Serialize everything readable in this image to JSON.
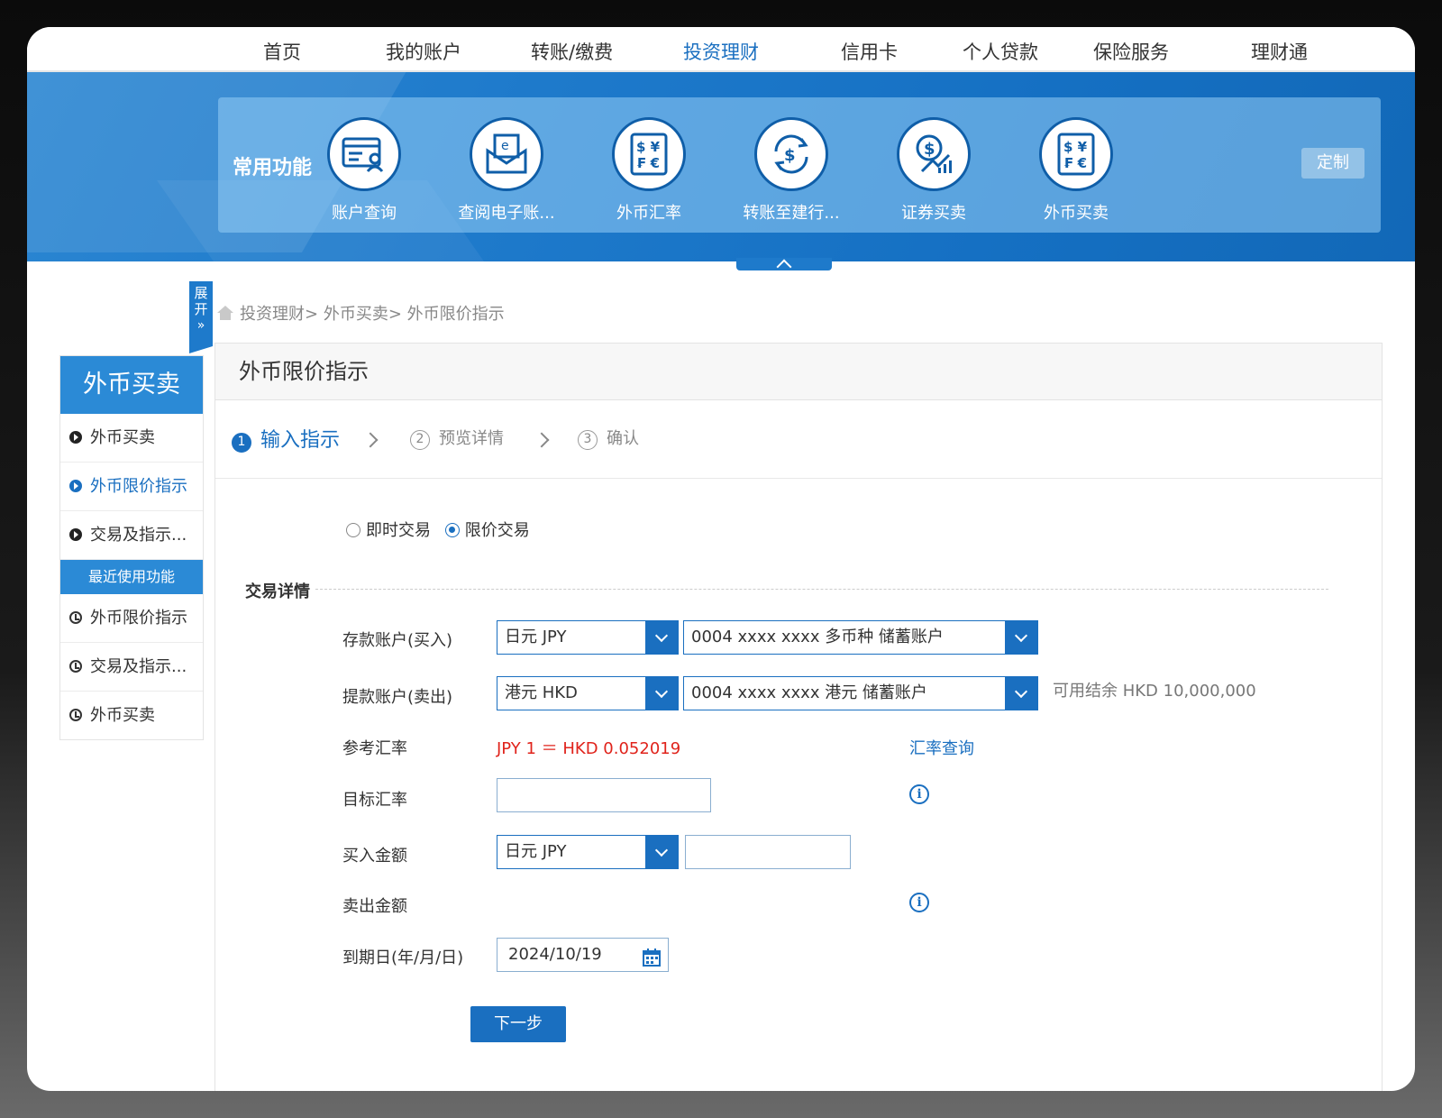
{
  "nav": {
    "items": [
      "首页",
      "我的账户",
      "转账/缴费",
      "投资理财",
      "信用卡",
      "个人贷款",
      "保险服务",
      "理财通"
    ],
    "active_index": 3
  },
  "favorites": {
    "title": "常用功能",
    "items": [
      {
        "label": "账户查询",
        "icon": "account-card-icon"
      },
      {
        "label": "查阅电子账...",
        "icon": "e-statement-icon"
      },
      {
        "label": "外币汇率",
        "icon": "currency-rate-icon"
      },
      {
        "label": "转账至建行...",
        "icon": "transfer-icon"
      },
      {
        "label": "证券买卖",
        "icon": "securities-icon"
      },
      {
        "label": "外币买卖",
        "icon": "fx-trade-icon"
      }
    ],
    "customize_label": "定制"
  },
  "expand_tab": {
    "label": "展开"
  },
  "breadcrumb": {
    "items": [
      "投资理财",
      "外币买卖",
      "外币限价指示"
    ],
    "separator": ">"
  },
  "sidebar": {
    "title": "外币买卖",
    "items": [
      {
        "label": "外币买卖",
        "active": false
      },
      {
        "label": "外币限价指示",
        "active": true
      },
      {
        "label": "交易及指示..."
      }
    ],
    "recent_title": "最近使用功能",
    "recent_items": [
      "外币限价指示",
      "交易及指示...",
      "外币买卖"
    ]
  },
  "page": {
    "title": "外币限价指示",
    "steps": [
      {
        "num": "1",
        "label": "输入指示"
      },
      {
        "num": "2",
        "label": "预览详情"
      },
      {
        "num": "3",
        "label": "确认"
      }
    ],
    "trade_types": [
      {
        "label": "即时交易",
        "checked": false
      },
      {
        "label": "限价交易",
        "checked": true
      }
    ],
    "section_title": "交易详情",
    "form": {
      "deposit_label": "存款账户(买入)",
      "deposit_currency": "日元 JPY",
      "deposit_account": "0004 xxxx xxxx 多币种 储蓄账户",
      "withdraw_label": "提款账户(卖出)",
      "withdraw_currency": "港元 HKD",
      "withdraw_account": "0004 xxxx xxxx 港元 储蓄账户",
      "available_balance": "可用结余 HKD 10,000,000",
      "ref_rate_label": "参考汇率",
      "ref_rate_value": "JPY 1 ＝ HKD 0.052019",
      "rate_query_link": "汇率查询",
      "target_rate_label": "目标汇率",
      "target_rate_value": "",
      "buy_amount_label": "买入金额",
      "buy_currency": "日元 JPY",
      "buy_amount_value": "",
      "sell_amount_label": "卖出金额",
      "expiry_label": "到期日(年/月/日)",
      "expiry_value": "2024/10/19"
    },
    "next_button": "下一步"
  },
  "colors": {
    "accent": "#1a6fc0",
    "banner": "#1e7acb",
    "rate_red": "#e0231b"
  }
}
